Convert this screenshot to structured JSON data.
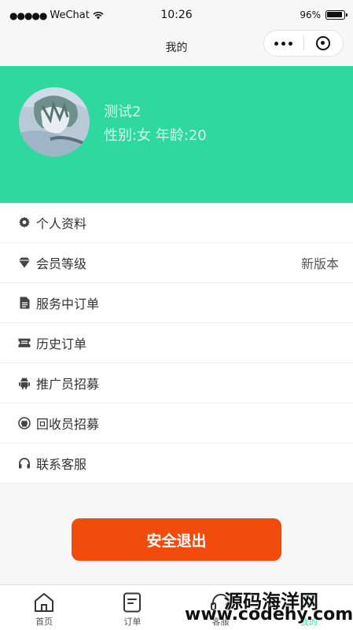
{
  "status_bar": {
    "carrier": "WeChat",
    "time": "10:26",
    "battery": "96%"
  },
  "navbar": {
    "title": "我的"
  },
  "profile": {
    "name": "测试2",
    "info": "性别:女 年龄:20"
  },
  "menu": [
    {
      "label": "个人资料",
      "icon": "gear-icon"
    },
    {
      "label": "会员等级",
      "icon": "diamond-icon",
      "extra": "新版本"
    },
    {
      "label": "服务中订单",
      "icon": "document-icon"
    },
    {
      "label": "历史订单",
      "icon": "ticket-icon"
    },
    {
      "label": "推广员招募",
      "icon": "android-icon"
    },
    {
      "label": "回收员招募",
      "icon": "github-icon"
    },
    {
      "label": "联系客服",
      "icon": "headset-icon"
    }
  ],
  "logout_label": "安全退出",
  "tabs": [
    {
      "label": "首页",
      "icon": "home-icon"
    },
    {
      "label": "订单",
      "icon": "order-icon"
    },
    {
      "label": "客服",
      "icon": "headset-icon"
    },
    {
      "label": "我的",
      "icon": "user-icon",
      "active": true
    }
  ],
  "watermark": {
    "line1": "源码海洋网",
    "line2": "www.codehy.com"
  },
  "colors": {
    "accent": "#2ed89e",
    "logout": "#f24c0c"
  }
}
